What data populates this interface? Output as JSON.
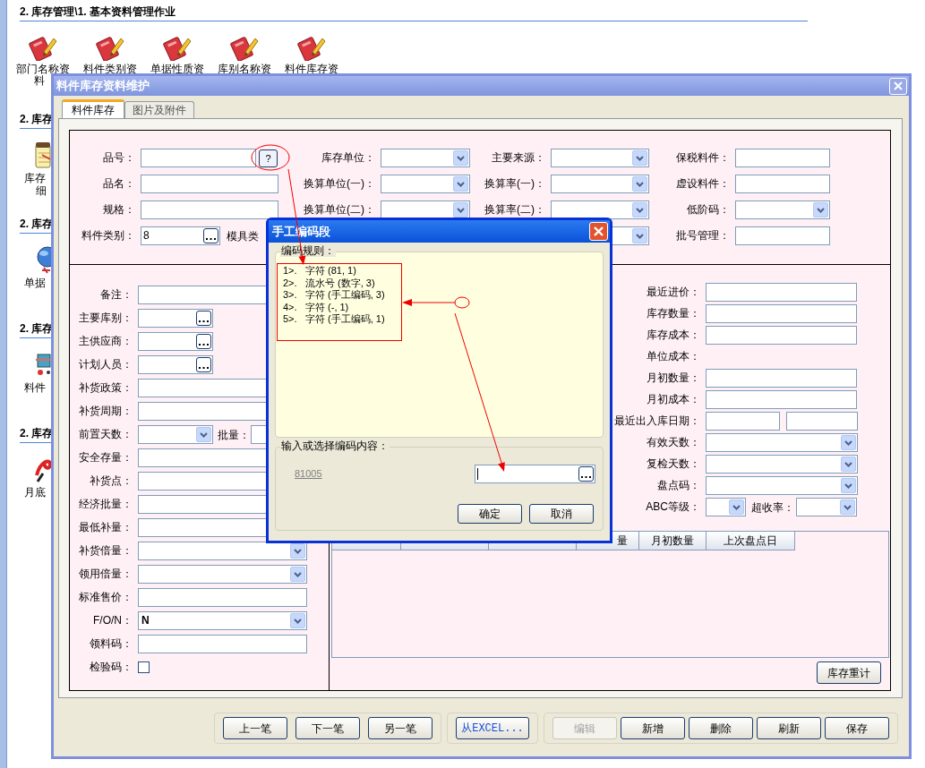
{
  "launcher": {
    "title": "2. 库存管理\\1. 基本资料管理作业",
    "top_items": [
      {
        "label": "部门名称资",
        "label_2": "料"
      },
      {
        "label": "料件类别资"
      },
      {
        "label": "单据性质资"
      },
      {
        "label": "库别名称资"
      },
      {
        "label": "料件库存资"
      }
    ],
    "sections": [
      {
        "heading": "2. 库存",
        "label": "库存",
        "label_2": "细"
      },
      {
        "heading": "2. 库存",
        "label": "单据"
      },
      {
        "heading": "2. 库存",
        "label": "料件"
      },
      {
        "heading": "2. 库存",
        "label": "月底"
      }
    ]
  },
  "window": {
    "title": "料件库存资料维护"
  },
  "tabs": [
    {
      "label": "料件库存",
      "selected": true
    },
    {
      "label": "图片及附件",
      "selected": false
    }
  ],
  "upper_rows": [
    [
      {
        "label": "品号：",
        "kind": "help",
        "button_text": "?"
      },
      {
        "label": "库存单位：",
        "kind": "combo"
      },
      {
        "label": "主要来源：",
        "kind": "combo"
      },
      {
        "label": "保税料件：",
        "kind": "text"
      }
    ],
    [
      {
        "label": "品名：",
        "kind": "text"
      },
      {
        "label": "换算单位(一)：",
        "kind": "combo"
      },
      {
        "label": "换算率(一)：",
        "kind": "combo"
      },
      {
        "label": "虚设料件：",
        "kind": "text"
      }
    ],
    [
      {
        "label": "规格：",
        "kind": "text"
      },
      {
        "label": "换算单位(二)：",
        "kind": "combo"
      },
      {
        "label": "换算率(二)：",
        "kind": "combo"
      },
      {
        "label": "低阶码：",
        "kind": "combo"
      }
    ],
    [
      {
        "label": "料件类别：",
        "kind": "lookup",
        "value": "8",
        "note": "模具类"
      },
      {
        "kind": "blank"
      },
      {
        "kind": "combo"
      },
      {
        "label": "批号管理：",
        "kind": "text"
      }
    ]
  ],
  "left_fields": [
    {
      "label": "备注：",
      "kind": "text"
    },
    {
      "label": "主要库别：",
      "kind": "lookup"
    },
    {
      "label": "主供应商：",
      "kind": "lookup"
    },
    {
      "label": "计划人员：",
      "kind": "lookup"
    },
    {
      "label": "补货政策：",
      "kind": "text"
    },
    {
      "label": "补货周期：",
      "kind": "text"
    },
    {
      "label": "前置天数：",
      "kind": "combo_with_qty",
      "qty_label": "批量："
    },
    {
      "label": "安全存量：",
      "kind": "text"
    },
    {
      "label": "补货点：",
      "kind": "text"
    },
    {
      "label": "经济批量：",
      "kind": "text"
    },
    {
      "label": "最低补量：",
      "kind": "text"
    },
    {
      "label": "补货倍量：",
      "kind": "combo"
    },
    {
      "label": "领用倍量：",
      "kind": "combo"
    },
    {
      "label": "标准售价：",
      "kind": "text"
    },
    {
      "label": "F/O/N：",
      "kind": "combo",
      "value": "N"
    },
    {
      "label": "领料码：",
      "kind": "text"
    },
    {
      "label": "检验码：",
      "kind": "checkbox",
      "checked": false
    }
  ],
  "right_fields": [
    {
      "label": "最近进价：",
      "kind": "text"
    },
    {
      "label": "库存数量：",
      "kind": "text"
    },
    {
      "label": "库存成本：",
      "kind": "text"
    },
    {
      "label": "单位成本：",
      "kind": "static"
    },
    {
      "label": "月初数量：",
      "kind": "text"
    },
    {
      "label": "月初成本：",
      "kind": "text"
    },
    {
      "label": "最近出入库日期：",
      "kind": "date_pair"
    },
    {
      "label": "有效天数：",
      "kind": "combo"
    },
    {
      "label": "复检天数：",
      "kind": "combo"
    },
    {
      "label": "盘点码：",
      "kind": "combo"
    },
    {
      "label": "ABC等级：",
      "kind": "combo_pair",
      "second_label": "超收率："
    }
  ],
  "table": {
    "columns": [
      "量",
      "月初数量",
      "上次盘点日"
    ]
  },
  "recalc_button": "库存重计",
  "button_groups": [
    [
      {
        "label": "上一笔",
        "disabled": false
      },
      {
        "label": "下一笔",
        "disabled": false
      },
      {
        "label": "另一笔",
        "disabled": false
      }
    ],
    [
      {
        "label": "从EXCEL...",
        "disabled": false,
        "kind": "import"
      }
    ],
    [
      {
        "label": "编辑",
        "disabled": true
      },
      {
        "label": "新增",
        "disabled": false
      },
      {
        "label": "删除",
        "disabled": false
      },
      {
        "label": "刷新",
        "disabled": false
      },
      {
        "label": "保存",
        "disabled": false
      }
    ]
  ],
  "dialog": {
    "title": "手工编码段",
    "rules_legend": "编码规则：",
    "rules": [
      {
        "index": "1>.",
        "text": "字符 (81, 1)"
      },
      {
        "index": "2>.",
        "text": "流水号 (数字, 3)"
      },
      {
        "index": "3>.",
        "text": "字符 (手工编码, 3)"
      },
      {
        "index": "4>.",
        "text": "字符 (-, 1)"
      },
      {
        "index": "5>.",
        "text": "字符 (手工编码, 1)"
      }
    ],
    "input_legend": "输入或选择编码内容：",
    "sample": "81005",
    "input_focused": true,
    "buttons": [
      "确定",
      "取消"
    ]
  }
}
